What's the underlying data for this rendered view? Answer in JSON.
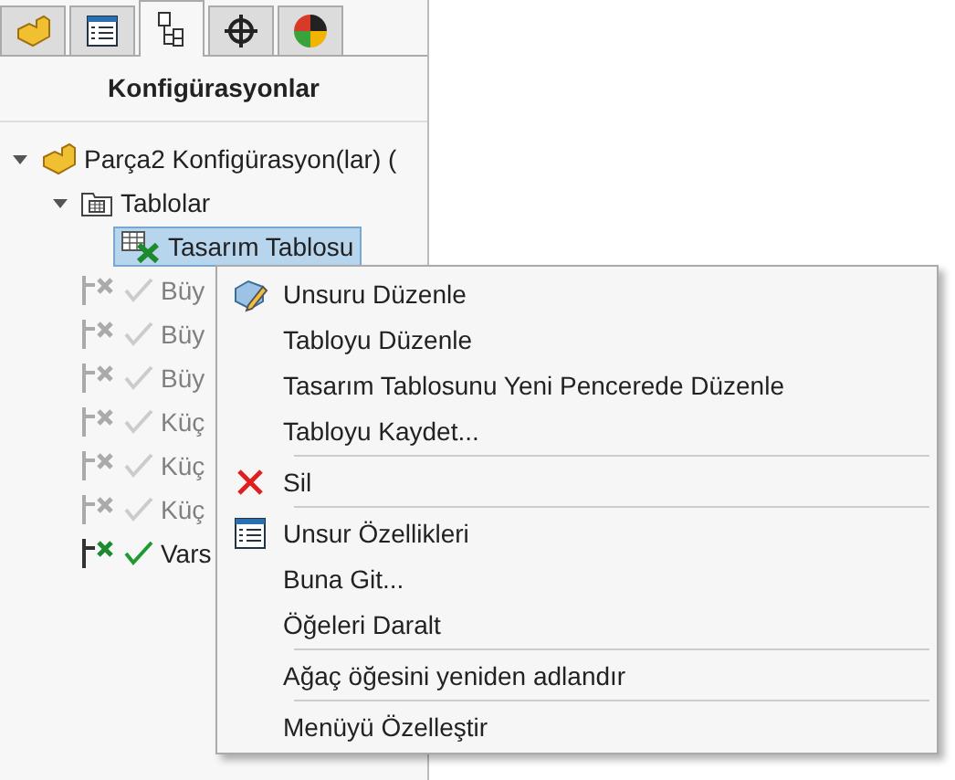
{
  "tabs": [
    {
      "kind": "part",
      "selected": false
    },
    {
      "kind": "properties",
      "selected": false
    },
    {
      "kind": "config",
      "selected": true
    },
    {
      "kind": "target",
      "selected": false
    },
    {
      "kind": "appearance",
      "selected": false
    }
  ],
  "panel_title": "Konfigürasyonlar",
  "tree": [
    {
      "kind": "part",
      "label": "Parça2 Konfigürasyon(lar)  (",
      "expanded": true,
      "selected": false,
      "children": [
        {
          "kind": "folder",
          "label": "Tablolar",
          "expanded": true,
          "selected": false,
          "children": [
            {
              "kind": "table",
              "label": "Tasarım Tablosu",
              "selected": true
            }
          ]
        },
        {
          "kind": "config",
          "label": "Büy",
          "active": false,
          "selected": false
        },
        {
          "kind": "config",
          "label": "Büy",
          "active": false,
          "selected": false
        },
        {
          "kind": "config",
          "label": "Büy",
          "active": false,
          "selected": false
        },
        {
          "kind": "config",
          "label": "Küç",
          "active": false,
          "selected": false
        },
        {
          "kind": "config",
          "label": "Küç",
          "active": false,
          "selected": false
        },
        {
          "kind": "config",
          "label": "Küç",
          "active": false,
          "selected": false
        },
        {
          "kind": "config",
          "label": "Vars",
          "active": true,
          "selected": false
        }
      ]
    }
  ],
  "context_menu": [
    {
      "kind": "edit",
      "label": "Unsuru Düzenle"
    },
    {
      "kind": "plain",
      "label": "Tabloyu Düzenle"
    },
    {
      "kind": "plain",
      "label": "Tasarım Tablosunu Yeni Pencerede Düzenle"
    },
    {
      "kind": "plain",
      "label": "Tabloyu Kaydet..."
    },
    {
      "kind": "separator"
    },
    {
      "kind": "delete",
      "label": "Sil"
    },
    {
      "kind": "separator"
    },
    {
      "kind": "properties",
      "label": "Unsur Özellikleri"
    },
    {
      "kind": "plain",
      "label": "Buna Git..."
    },
    {
      "kind": "plain",
      "label": "Öğeleri Daralt"
    },
    {
      "kind": "separator"
    },
    {
      "kind": "plain",
      "label": "Ağaç öğesini yeniden adlandır"
    },
    {
      "kind": "separator"
    },
    {
      "kind": "plain",
      "label": "Menüyü Özelleştir"
    }
  ]
}
